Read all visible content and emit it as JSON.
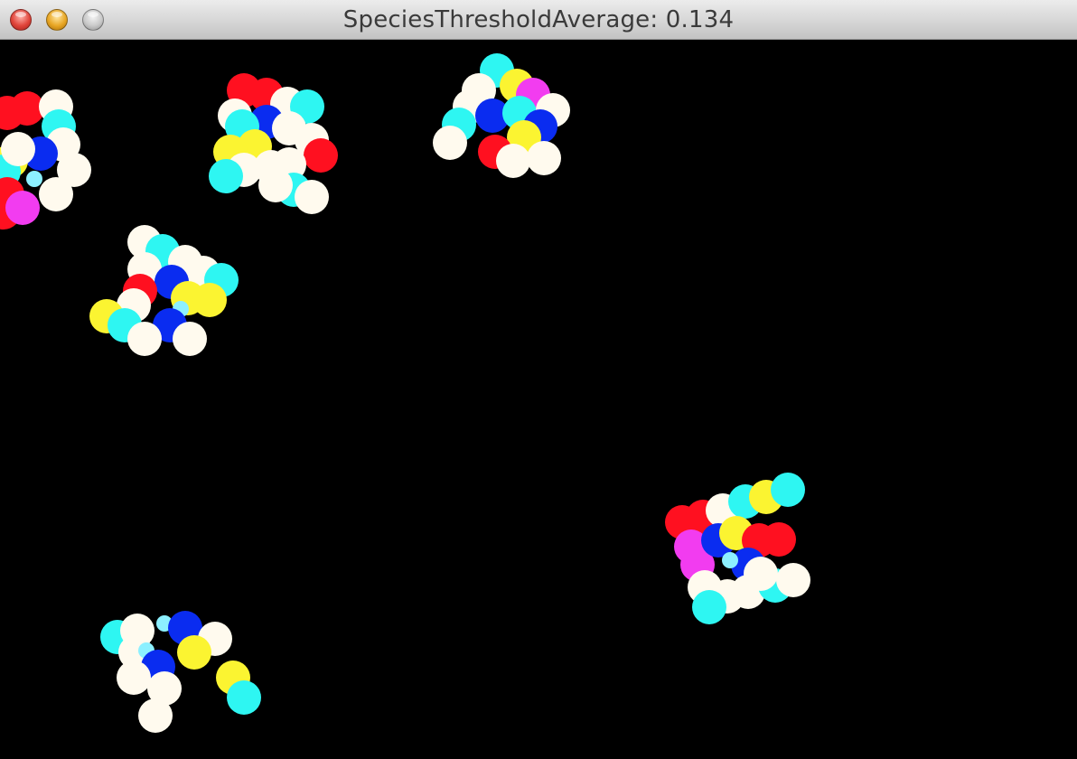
{
  "window": {
    "title": "SpeciesThresholdAverage: 0.134"
  },
  "colors": {
    "red": "#ff1020",
    "white": "#fffaee",
    "cyan": "#2ef6f2",
    "yellow": "#fbf431",
    "blue": "#0a2cf0",
    "magenta": "#f23cf0",
    "light_cyan": "#8cf0ff"
  }
}
